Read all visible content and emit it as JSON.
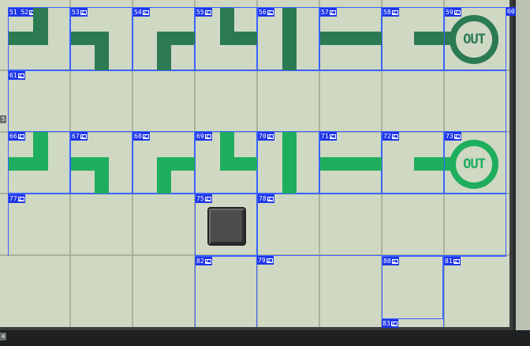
{
  "board": {
    "row1_tiles": [
      {
        "id": "52",
        "label": "51 52"
      },
      {
        "id": "53",
        "label": "53"
      },
      {
        "id": "54",
        "label": "54"
      },
      {
        "id": "55",
        "label": "55"
      },
      {
        "id": "56",
        "label": "56"
      },
      {
        "id": "57",
        "label": "57"
      },
      {
        "id": "58",
        "label": "58"
      },
      {
        "id": "59",
        "label": "59"
      }
    ],
    "row1_edge_label": "60",
    "row2_label": "61",
    "row3_tiles": [
      {
        "id": "66",
        "label": "66"
      },
      {
        "id": "67",
        "label": "67"
      },
      {
        "id": "68",
        "label": "68"
      },
      {
        "id": "69",
        "label": "69"
      },
      {
        "id": "70",
        "label": "70"
      },
      {
        "id": "71",
        "label": "71"
      },
      {
        "id": "72",
        "label": "72"
      },
      {
        "id": "73",
        "label": "73"
      }
    ],
    "lower_labels": {
      "c77": "77",
      "c75": "75",
      "c78": "78",
      "c82": "82",
      "c79": "79",
      "c80": "80",
      "c81": "81",
      "c83": "83"
    },
    "exit_text": "OUT",
    "side_marker": "5",
    "bottom_marker": "4"
  },
  "colors": {
    "board_bg": "#cfd8c3",
    "pipe_dark": "#2c7a52",
    "pipe_light": "#1fae5d",
    "annotation_blue": "#1e36e8"
  },
  "icons": {
    "tile_tag": "image-icon",
    "block": "stone-block-icon"
  }
}
